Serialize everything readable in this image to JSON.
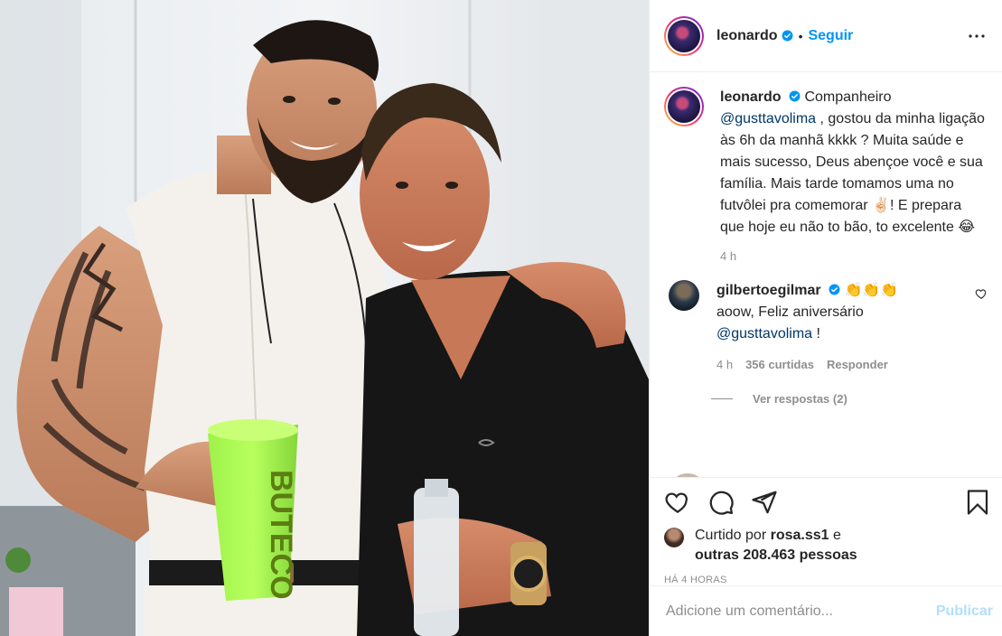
{
  "post": {
    "author": "leonardo",
    "follow_label": "Seguir",
    "separator": "•"
  },
  "caption": {
    "author": "leonardo",
    "text_before": "Companheiro",
    "mention": "@gusttavolima",
    "text_after": ", gostou da minha ligação às 6h da manhã kkkk ? Muita saúde e mais sucesso, Deus abençoe você e sua família. Mais tarde tomamos uma no futvôlei pra comemorar ✌🏻! E prepara que hoje eu não to bão, to excelente 😂",
    "age": "4 h"
  },
  "comment": {
    "author": "gilbertoegilmar",
    "emoji": "👏👏👏",
    "text": "aoow, Feliz aniversário",
    "mention": "@gusttavolima",
    "suffix": " !",
    "age": "4 h",
    "likes": "356 curtidas",
    "reply_label": "Responder",
    "view_replies": "Ver respostas (2)"
  },
  "likes": {
    "prefix": "Curtido por ",
    "user": "rosa.ss1",
    "conj": " e",
    "others": "outras 208.463 pessoas"
  },
  "timestamp": "HÁ 4 HORAS",
  "add_comment": {
    "placeholder": "Adicione um comentário...",
    "post_label": "Publicar"
  },
  "photo": {
    "cup_text": "BUTECO"
  },
  "colors": {
    "accent": "#0095f6",
    "verified": "#0095f6",
    "mention": "#00376b",
    "muted": "#8e8e8e"
  },
  "icons": [
    "verified-icon",
    "more-options-icon",
    "heart-icon",
    "comment-icon",
    "share-icon",
    "bookmark-icon",
    "heart-small-icon"
  ]
}
